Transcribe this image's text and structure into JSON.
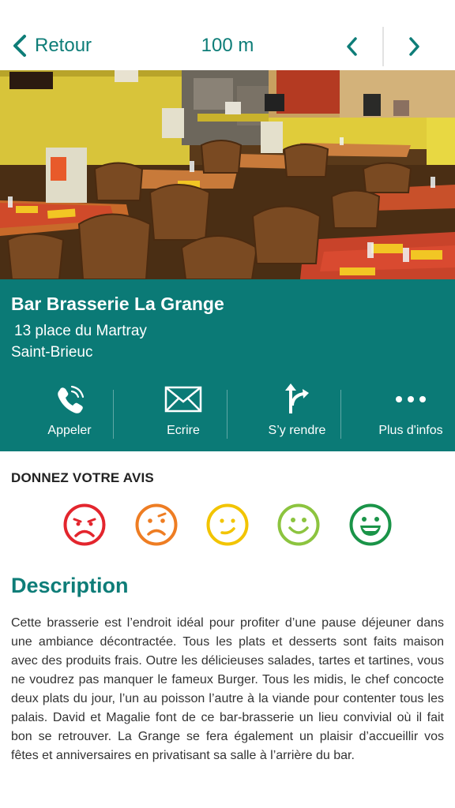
{
  "header": {
    "back_label": "Retour",
    "distance": "100 m",
    "back_icon": "chevron-left-icon",
    "prev_icon": "chevron-left-icon",
    "next_icon": "chevron-right-icon"
  },
  "gallery": {
    "image_description": "interior of a brasserie dining room with wooden chairs and tables",
    "page_count": 2,
    "current_page": 1
  },
  "place": {
    "name": "Bar Brasserie La Grange",
    "address_line1": "13 place du Martray",
    "address_line2": "Saint-Brieuc"
  },
  "actions": [
    {
      "label": "Appeler",
      "icon": "phone-icon"
    },
    {
      "label": "Ecrire",
      "icon": "mail-icon"
    },
    {
      "label": "S’y rendre",
      "icon": "directions-icon"
    },
    {
      "label": "Plus d'infos",
      "icon": "more-icon"
    }
  ],
  "review": {
    "title": "DONNEZ VOTRE AVIS",
    "ratings": [
      {
        "icon": "very-sad-face-icon",
        "color": "#e3252d"
      },
      {
        "icon": "sad-face-icon",
        "color": "#ee7d23"
      },
      {
        "icon": "neutral-face-icon",
        "color": "#f2c400"
      },
      {
        "icon": "happy-face-icon",
        "color": "#8cc43f"
      },
      {
        "icon": "very-happy-face-icon",
        "color": "#1a9448"
      }
    ]
  },
  "description": {
    "title": "Description",
    "text": "Cette brasserie est l’endroit idéal pour profiter d’une pause déjeuner dans une ambiance décontractée. Tous les plats et desserts sont faits maison avec des produits frais. Outre les délicieuses salades, tartes et tartines, vous ne voudrez pas manquer le fameux Burger. Tous les midis, le chef concocte deux plats du jour, l’un au poisson l’autre à la viande pour contenter tous les palais. David et Magalie font de ce bar-brasserie un lieu convivial où il fait bon se retrouver. La Grange se fera également un plaisir d’accueillir vos fêtes et anniversaires en privatisant sa salle à l’arrière du bar."
  },
  "colors": {
    "accent": "#0e7d78",
    "info_background": "#0b7a76"
  }
}
